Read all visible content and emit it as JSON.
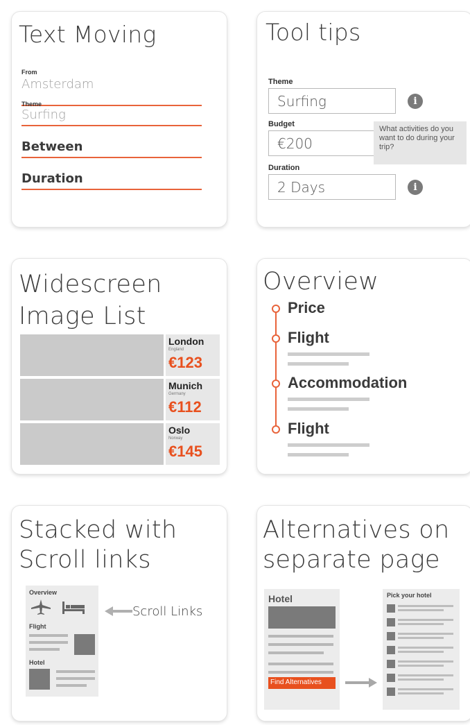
{
  "text_moving": {
    "title": "Text Moving",
    "from_label": "From",
    "from_value": "Amsterdam",
    "theme_label": "Theme",
    "theme_value": "Surfing",
    "between_placeholder": "Between",
    "duration_placeholder": "Duration"
  },
  "tool_tips": {
    "title": "Tool tips",
    "theme_label": "Theme",
    "theme_value": "Surfing",
    "budget_label": "Budget",
    "budget_value": "€200",
    "duration_label": "Duration",
    "duration_value": "2 Days",
    "info_glyph": "i",
    "tooltip_text": "What activities do you want to do during your trip?"
  },
  "widescreen_list": {
    "title_line1": "Widescreen",
    "title_line2": "Image List",
    "items": [
      {
        "city": "London",
        "country": "England",
        "price": "€123"
      },
      {
        "city": "Munich",
        "country": "Germany",
        "price": "€112"
      },
      {
        "city": "Oslo",
        "country": "Norway",
        "price": "€145"
      }
    ]
  },
  "overview": {
    "title": "Overview",
    "steps": [
      {
        "label": "Price"
      },
      {
        "label": "Flight"
      },
      {
        "label": "Accommodation"
      },
      {
        "label": "Flight"
      }
    ]
  },
  "stacked": {
    "title_line1": "Stacked with",
    "title_line2": "Scroll links",
    "overview_label": "Overview",
    "flight_label": "Flight",
    "hotel_label": "Hotel",
    "scroll_links_label": "Scroll Links",
    "icons": [
      "plane-icon",
      "bed-icon",
      "arrow-left-icon"
    ]
  },
  "alternatives": {
    "title_line1": "Alternatives on",
    "title_line2": "separate page",
    "hotel_label": "Hotel",
    "find_button": "Find Alternatives",
    "pick_label": "Pick your hotel",
    "accent_color": "#e8501e"
  },
  "colors": {
    "accent": "#e8633a",
    "price": "#e8501e",
    "placeholder_gray": "#cacaca"
  }
}
